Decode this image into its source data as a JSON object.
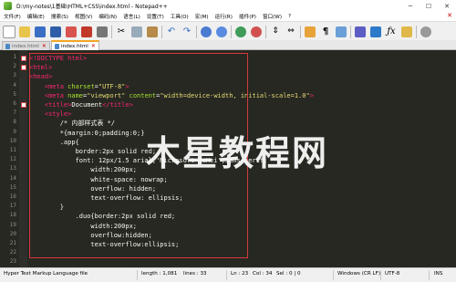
{
  "window": {
    "title": "D:\\my-notes\\1基础\\HTML+CSS\\index.html - Notepad++",
    "controls": {
      "minimize": "─",
      "maximize": "☐",
      "close": "✕"
    }
  },
  "menu": {
    "items": [
      "文件(F)",
      "编辑(E)",
      "搜索(S)",
      "视图(V)",
      "编码(N)",
      "语言(L)",
      "设置(T)",
      "工具(O)",
      "宏(M)",
      "运行(R)",
      "插件(P)",
      "窗口(W)",
      "?"
    ],
    "close_label": "✕"
  },
  "toolbar": {
    "icons": [
      "new-file",
      "open-file",
      "save",
      "save-all",
      "close",
      "close-all",
      "print",
      "cut",
      "copy",
      "paste",
      "undo",
      "redo",
      "find",
      "replace",
      "zoom-in",
      "zoom-out",
      "sync-vertical",
      "sync-horizontal",
      "word-wrap",
      "show-all-chars",
      "indent-guide",
      "user-language",
      "doc-map",
      "function-list",
      "folder-as-workspace",
      "monitoring"
    ]
  },
  "tabs": [
    {
      "label": "index.html",
      "active": false
    },
    {
      "label": "index.html",
      "active": true
    }
  ],
  "editor": {
    "line_numbers": [
      "1",
      "2",
      "3",
      "4",
      "5",
      "6",
      "7",
      "8",
      "9",
      "10",
      "11",
      "12",
      "13",
      "14",
      "15",
      "16",
      "17",
      "18",
      "19",
      "20",
      "21",
      "22",
      "23"
    ],
    "fold_lines": [
      1,
      2,
      6
    ],
    "lines": [
      [
        [
          "c-tag",
          "<!DOCTYPE html>"
        ]
      ],
      [
        [
          "c-tag",
          "<html>"
        ]
      ],
      [
        [
          "c-tag",
          "<head>"
        ]
      ],
      [
        [
          "c-txt",
          "    "
        ],
        [
          "c-tag",
          "<meta "
        ],
        [
          "c-attr",
          "charset"
        ],
        [
          "c-txt",
          "="
        ],
        [
          "c-str",
          "\"UTF-8\""
        ],
        [
          "c-tag",
          ">"
        ]
      ],
      [
        [
          "c-txt",
          "    "
        ],
        [
          "c-tag",
          "<meta "
        ],
        [
          "c-attr",
          "name"
        ],
        [
          "c-txt",
          "="
        ],
        [
          "c-str",
          "\"viewport\""
        ],
        [
          "c-txt",
          " "
        ],
        [
          "c-attr",
          "content"
        ],
        [
          "c-txt",
          "="
        ],
        [
          "c-str",
          "\"width=device-width, initial-scale=1.0\""
        ],
        [
          "c-tag",
          ">"
        ]
      ],
      [
        [
          "c-txt",
          "    "
        ],
        [
          "c-tag",
          "<title>"
        ],
        [
          "c-txt",
          "Document"
        ],
        [
          "c-tag",
          "</title>"
        ]
      ],
      [
        [
          "c-txt",
          "    "
        ],
        [
          "c-tag",
          "<style>"
        ]
      ],
      [
        [
          "c-txt",
          "        "
        ],
        [
          "c-com",
          "/* 内部样式表 */"
        ]
      ],
      [
        [
          "c-txt",
          "        *{margin:0;padding:0;}"
        ]
      ],
      [
        [
          "c-txt",
          "        .app{"
        ]
      ],
      [
        [
          "c-txt",
          "            border:2px solid red;"
        ]
      ],
      [
        [
          "c-txt",
          "            font: 12px/1.5 arial,'Microsoft YaHei',sans-serif;"
        ]
      ],
      [
        [
          "c-txt",
          "                width:200px;"
        ]
      ],
      [
        [
          "c-txt",
          "                white-space: nowrap;"
        ]
      ],
      [
        [
          "c-txt",
          "                overflow: hidden;"
        ]
      ],
      [
        [
          "c-txt",
          "                text-overflow: ellipsis;"
        ]
      ],
      [
        [
          "c-txt",
          "        }"
        ]
      ],
      [
        [
          "c-txt",
          "            .duo{border:2px solid red;"
        ]
      ],
      [
        [
          "c-txt",
          "                width:200px;"
        ]
      ],
      [
        [
          "c-txt",
          "                overflow:hidden;"
        ]
      ],
      [
        [
          "c-txt",
          "                text-overflow:ellipsis;"
        ]
      ],
      [
        [
          "c-txt",
          ""
        ]
      ],
      [
        [
          "c-txt",
          ""
        ]
      ]
    ],
    "watermark": "木星教程网"
  },
  "status": {
    "language": "Hyper Text Markup Language file",
    "length": "length : 1,081",
    "lines": "lines : 33",
    "position": "Ln : 23",
    "column": "Col : 34",
    "selection": "Sel : 0 | 0",
    "eol": "Windows (CR LF)",
    "encoding": "UTF-8",
    "mode": "INS"
  },
  "colors": {
    "editor_bg": "#272822",
    "tag": "#f92672",
    "attr": "#a6e22e",
    "string": "#e6db74",
    "text": "#f8f8f2",
    "highlight_box": "#d63a3a"
  }
}
